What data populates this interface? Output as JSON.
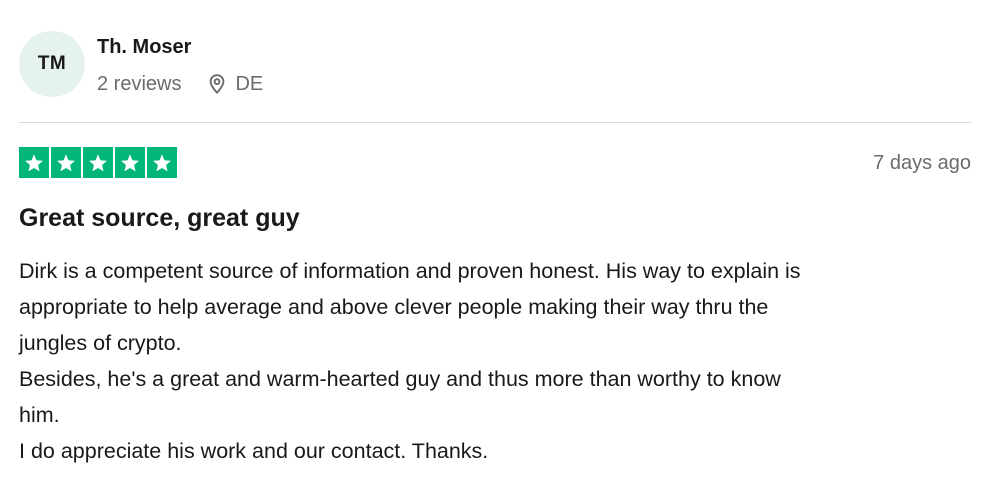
{
  "reviewer": {
    "initials": "TM",
    "name": "Th. Moser",
    "reviews": "2 reviews",
    "location": "DE"
  },
  "review": {
    "rating": 5,
    "rating_max": 5,
    "date": "7 days ago",
    "title": "Great source, great guy",
    "body_lines": [
      "Dirk is a competent source of information and proven honest. His way to explain is",
      "appropriate to help average and above clever people making their way thru the",
      "jungles of crypto.",
      "Besides, he's a great and warm-hearted guy and thus more than worthy to know",
      "him.",
      "I do appreciate his work and our contact. Thanks."
    ]
  },
  "colors": {
    "star_fill": "#00b67a",
    "avatar_bg": "#e5f2f0",
    "muted_text": "#6b6b6b",
    "divider": "#dcdce6"
  },
  "icons": {
    "location": "map-pin-icon",
    "rating": "star-icon"
  }
}
